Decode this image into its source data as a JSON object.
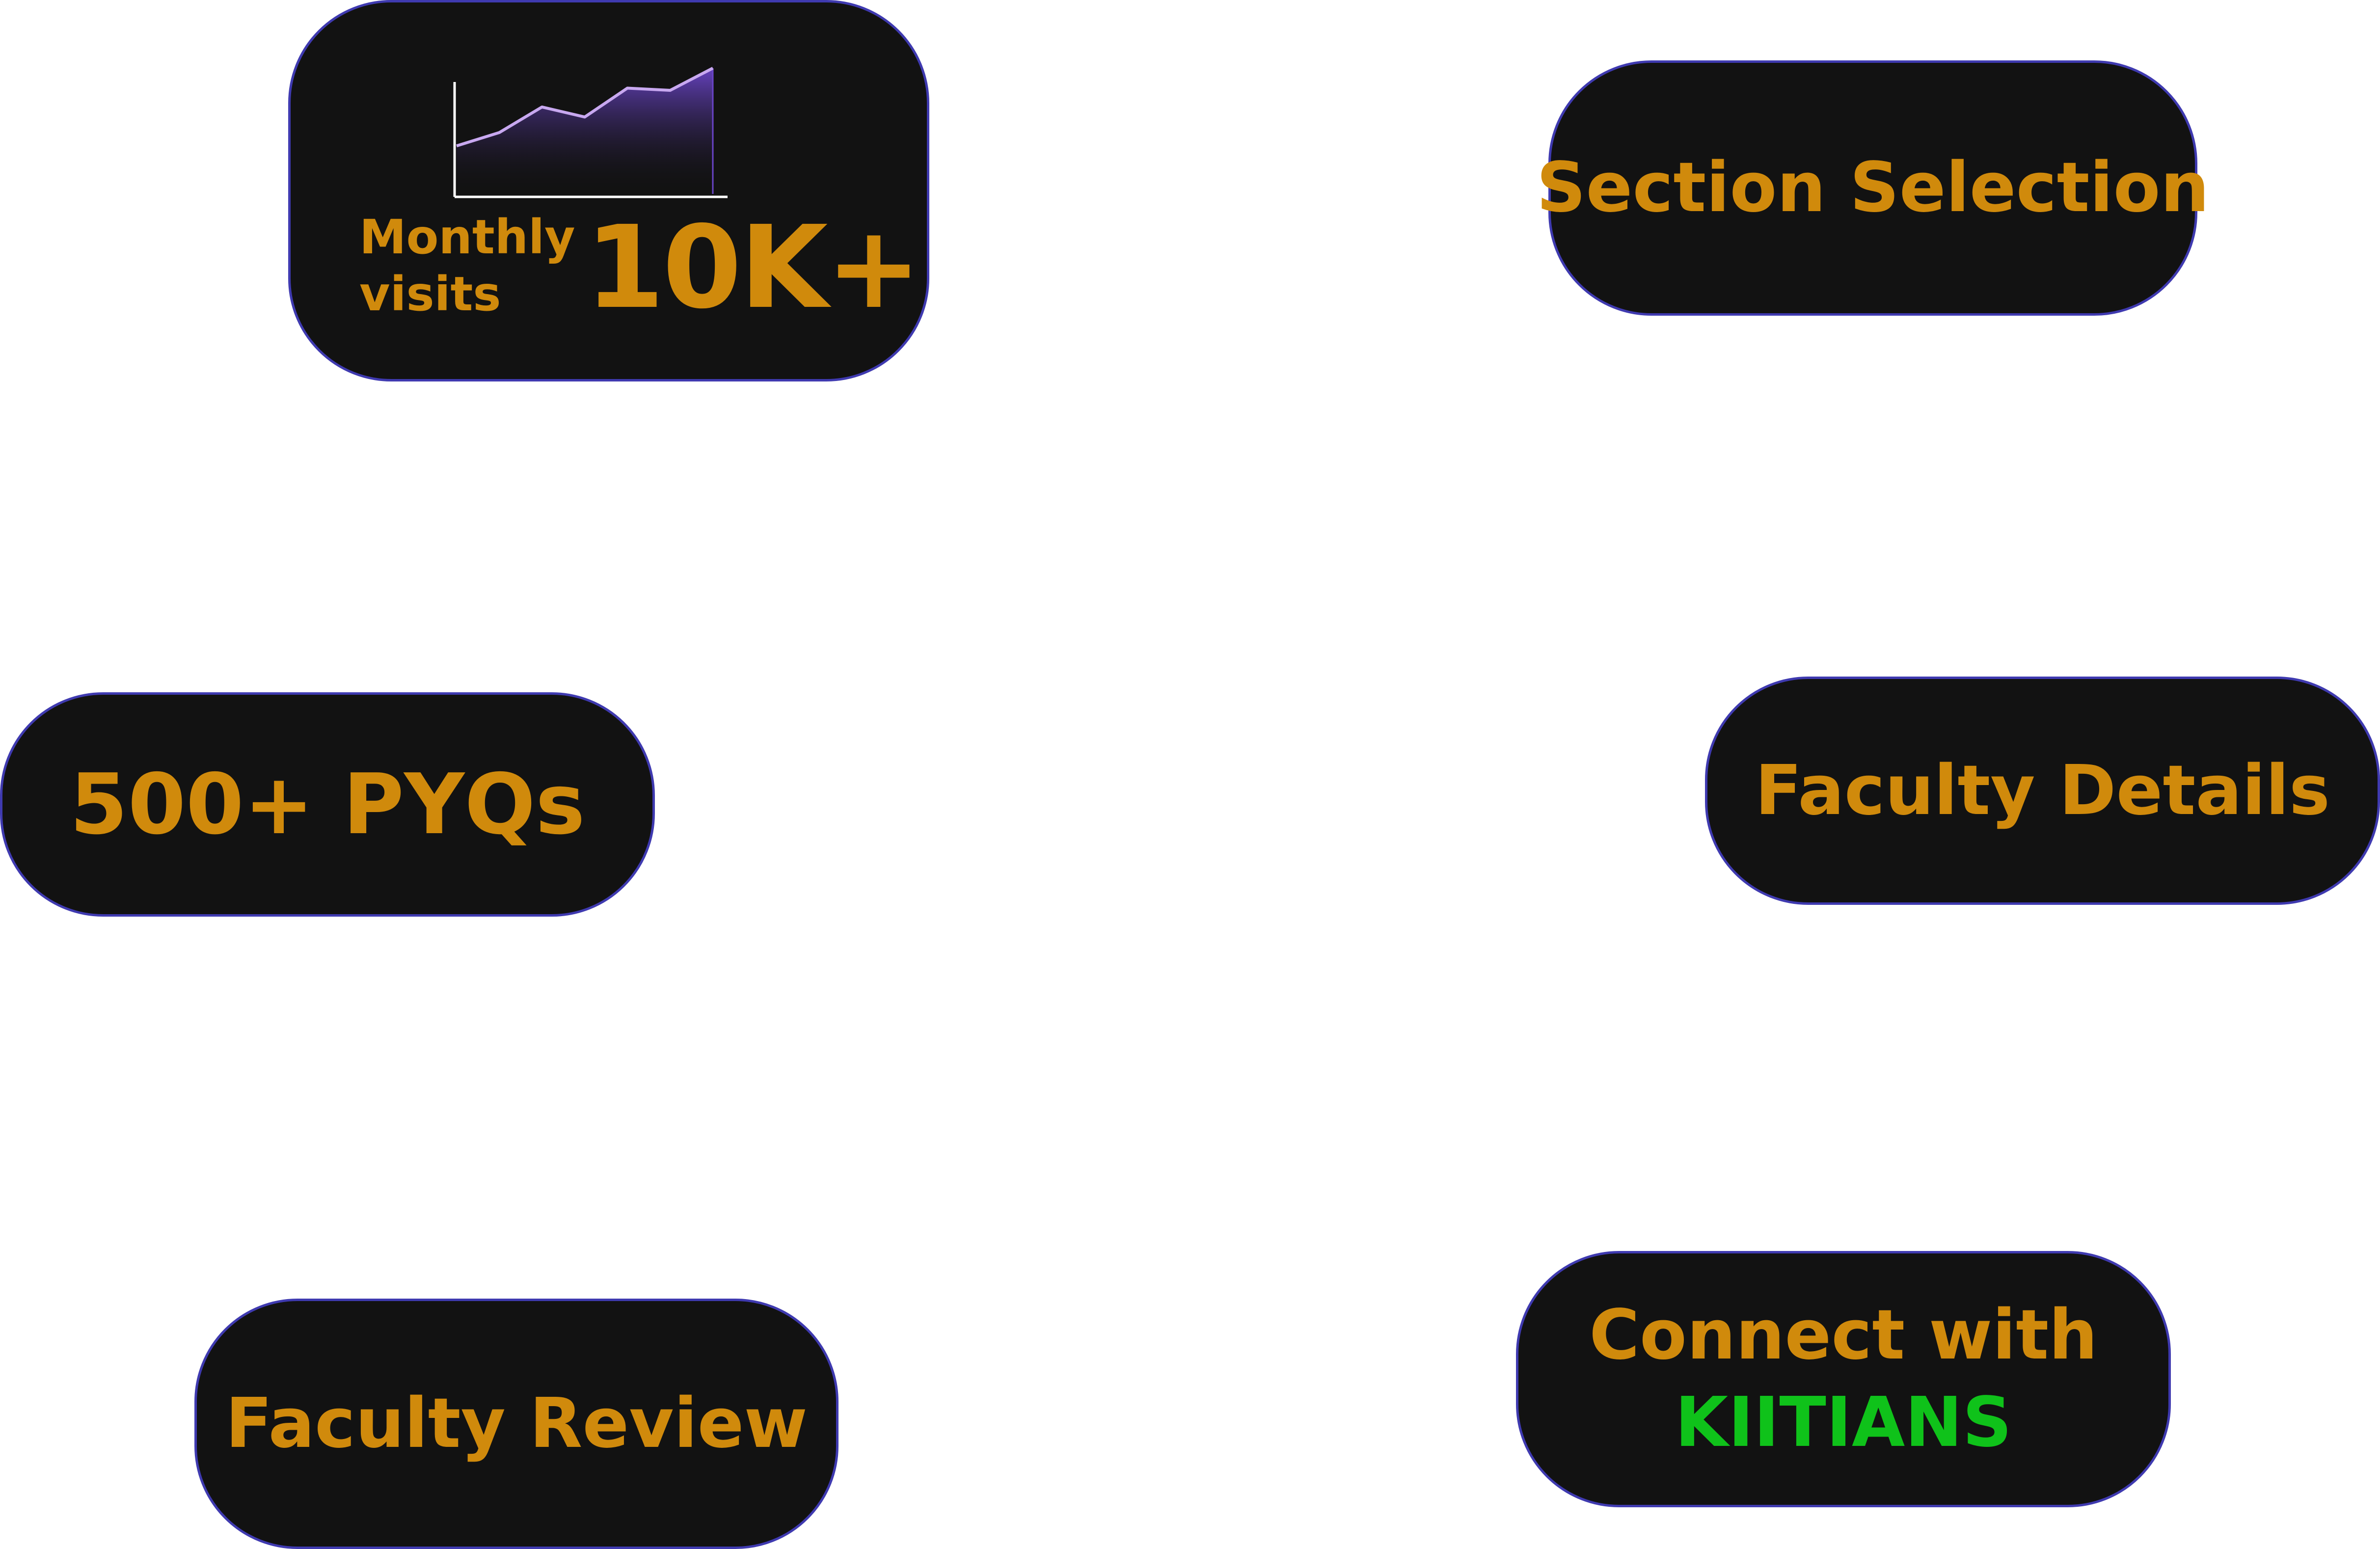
{
  "colors": {
    "card_background": "#121212",
    "card_border": "#3f3ab0",
    "text_accent": "#d08a0c",
    "highlight_green": "#0fc21a",
    "chart_line": "#c8a8f0",
    "chart_fill_top": "#6a44c8"
  },
  "stats": {
    "visits_caption": "Monthly visits",
    "visits_value": "10K+",
    "visits_trend": [
      0.3,
      0.42,
      0.65,
      0.56,
      0.82,
      0.8,
      1.0
    ]
  },
  "cards": {
    "section_selection": "Section Selection",
    "pyqs": "500+ PYQs",
    "faculty_details": "Faculty Details",
    "faculty_review": "Faculty Review",
    "connect_line1": "Connect with",
    "connect_line2": "KIITIANS"
  }
}
